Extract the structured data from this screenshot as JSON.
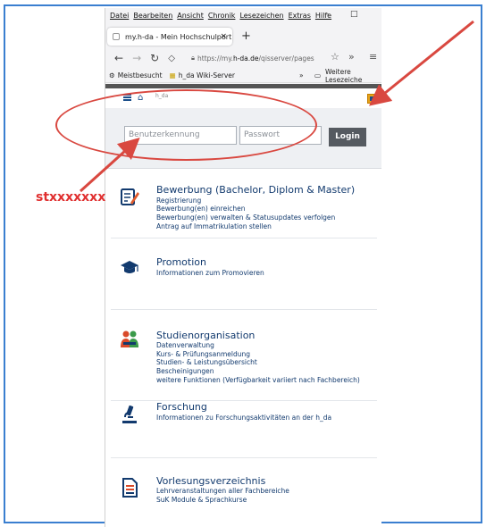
{
  "menu": [
    "Datei",
    "Bearbeiten",
    "Ansicht",
    "Chronik",
    "Lesezeichen",
    "Extras",
    "Hilfe"
  ],
  "window_controls": {
    "minimize": "–",
    "maximize": "□"
  },
  "tab": {
    "title": "my.h-da - Mein Hochschulport",
    "close": "×",
    "new_tab": "+"
  },
  "address": {
    "prefix": "https://my.",
    "domain": "h-da.de",
    "suffix": "/qisserver/pages",
    "more": "»",
    "menu": "≡"
  },
  "bookmarks": {
    "item1": "Meistbesucht",
    "item2": "h_da Wiki-Server",
    "overflow": "»",
    "other": "Weitere Lesezeiche"
  },
  "topnav": {
    "logo_text": "h_da"
  },
  "login": {
    "username_placeholder": "Benutzerkennung",
    "password_placeholder": "Passwort",
    "button": "Login"
  },
  "annotation": {
    "username_hint": "stxxxxxxx"
  },
  "cards": [
    {
      "title": "Bewerbung (Bachelor, Diplom & Master)",
      "lines": [
        "Registrierung",
        "Bewerbung(en) einreichen",
        "Bewerbung(en) verwalten & Statusupdates verfolgen",
        "Antrag auf Immatrikulation stellen"
      ],
      "icon": "application-form-icon"
    },
    {
      "title": "Promotion",
      "lines": [
        "Informationen zum Promovieren"
      ],
      "icon": "graduation-cap-icon"
    },
    {
      "title": "Studienorganisation",
      "lines": [
        "Datenverwaltung",
        "Kurs- & Prüfungsanmeldung",
        "Studien- & Leistungsübersicht",
        "Bescheinigungen",
        "weitere Funktionen (Verfügbarkeit variiert nach Fachbereich)"
      ],
      "icon": "people-icon"
    },
    {
      "title": "Forschung",
      "lines": [
        "Informationen zu Forschungsaktivitäten an der h_da"
      ],
      "icon": "microscope-icon"
    },
    {
      "title": "Vorlesungsverzeichnis",
      "lines": [
        "Lehrveranstaltungen aller Fachbereiche",
        "SuK Module & Sprachkurse"
      ],
      "icon": "document-icon"
    }
  ],
  "colors": {
    "annotation_red": "#d94840",
    "brand_blue": "#123a6e",
    "frame_blue": "#3a7fd0"
  }
}
